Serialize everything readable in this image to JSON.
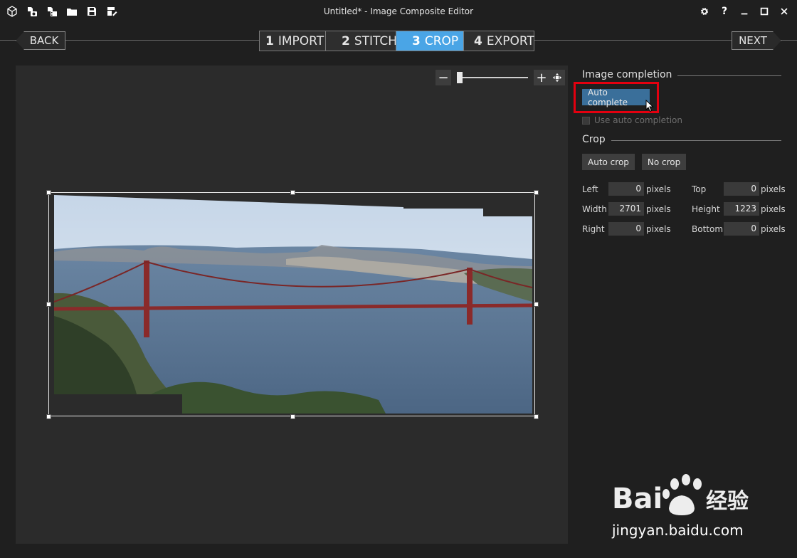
{
  "window": {
    "title": "Untitled* - Image Composite Editor"
  },
  "toolbar": {
    "icons": [
      "new-panorama-icon",
      "new-from-images-icon",
      "new-from-video-icon",
      "open-icon",
      "save-icon",
      "export-icon"
    ]
  },
  "window_controls": {
    "help_label": "?"
  },
  "nav": {
    "back_label": "BACK",
    "next_label": "NEXT",
    "steps": [
      {
        "num": "1",
        "label": "IMPORT"
      },
      {
        "num": "2",
        "label": "STITCH"
      },
      {
        "num": "3",
        "label": "CROP"
      },
      {
        "num": "4",
        "label": "EXPORT"
      }
    ],
    "active_step": 3
  },
  "zoom": {
    "minus_label": "−",
    "plus_label": "+",
    "level": 0.0
  },
  "panel": {
    "image_completion": {
      "title": "Image completion",
      "auto_complete_label": "Auto complete",
      "use_auto_completion_label": "Use auto completion",
      "use_auto_completion_checked": false
    },
    "crop": {
      "title": "Crop",
      "auto_crop_label": "Auto crop",
      "no_crop_label": "No crop",
      "fields": {
        "left": {
          "label": "Left",
          "value": "0",
          "unit": "pixels"
        },
        "top": {
          "label": "Top",
          "value": "0",
          "unit": "pixels"
        },
        "width": {
          "label": "Width",
          "value": "2701",
          "unit": "pixels"
        },
        "height": {
          "label": "Height",
          "value": "1223",
          "unit": "pixels"
        },
        "right": {
          "label": "Right",
          "value": "0",
          "unit": "pixels"
        },
        "bottom": {
          "label": "Bottom",
          "value": "0",
          "unit": "pixels"
        }
      }
    }
  },
  "watermark": {
    "brand": "Bai du 经验",
    "url": "jingyan.baidu.com"
  },
  "colors": {
    "accent": "#4aa5e6",
    "primary_button": "#3a6f9a",
    "highlight": "#e3000f",
    "background": "#1f1f1f",
    "canvas": "#2b2b2b"
  }
}
